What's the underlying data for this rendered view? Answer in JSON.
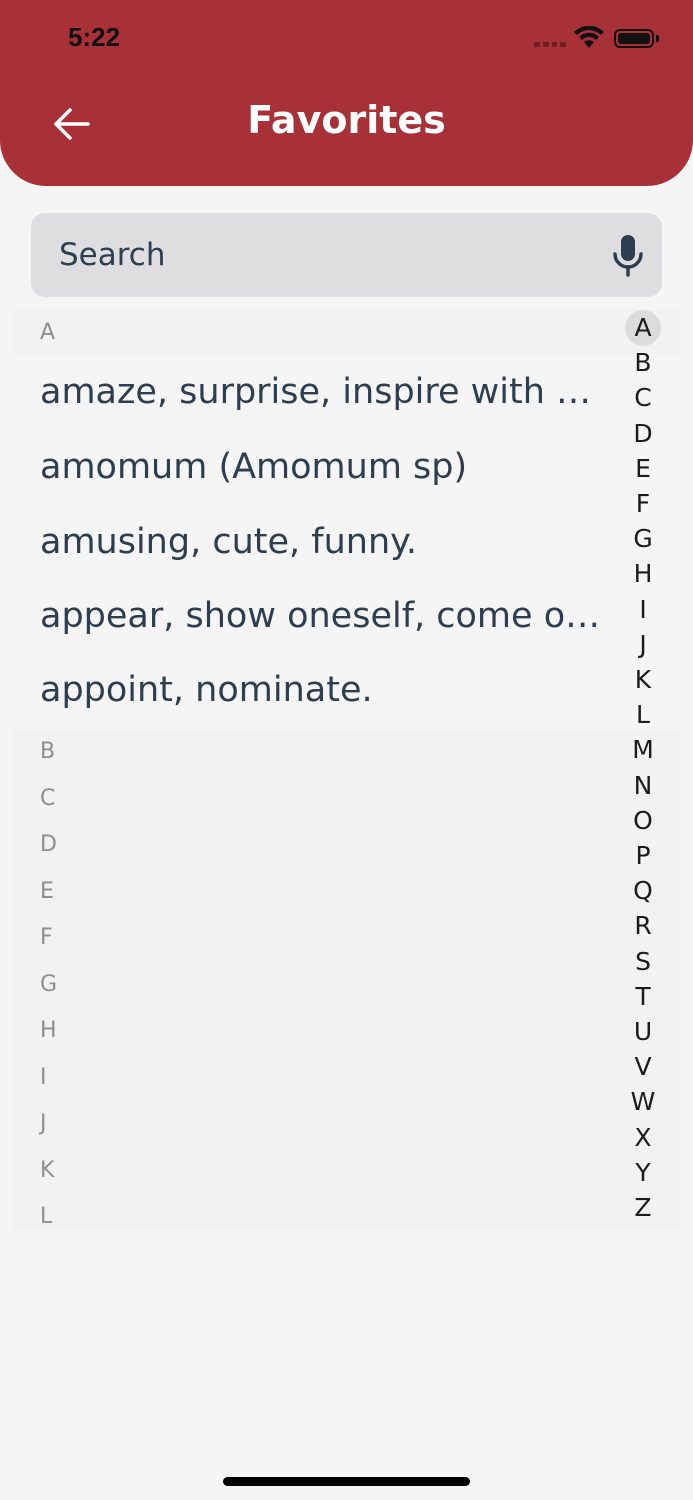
{
  "status_bar": {
    "time": "5:22"
  },
  "header": {
    "title": "Favorites",
    "back_icon": "arrow-left-icon"
  },
  "search": {
    "placeholder": "Search",
    "mic_icon": "microphone-icon"
  },
  "sections": {
    "a": {
      "letter": "A",
      "entries": [
        "amaze,    surprise, inspire with wonder.",
        "amomum (Amomum sp)",
        "amusing, cute, funny.",
        "appear,  show  oneself,  come out.",
        "appoint, nominate."
      ]
    },
    "empty": [
      "B",
      "C",
      "D",
      "E",
      "F",
      "G",
      "H",
      "I",
      "J",
      "K",
      "L"
    ]
  },
  "index": {
    "letters": [
      "A",
      "B",
      "C",
      "D",
      "E",
      "F",
      "G",
      "H",
      "I",
      "J",
      "K",
      "L",
      "M",
      "N",
      "O",
      "P",
      "Q",
      "R",
      "S",
      "T",
      "U",
      "V",
      "W",
      "X",
      "Y",
      "Z"
    ],
    "active": "A"
  },
  "colors": {
    "accent": "#a83037",
    "text": "#2d3e50",
    "section_letter": "#8e8e8e"
  }
}
